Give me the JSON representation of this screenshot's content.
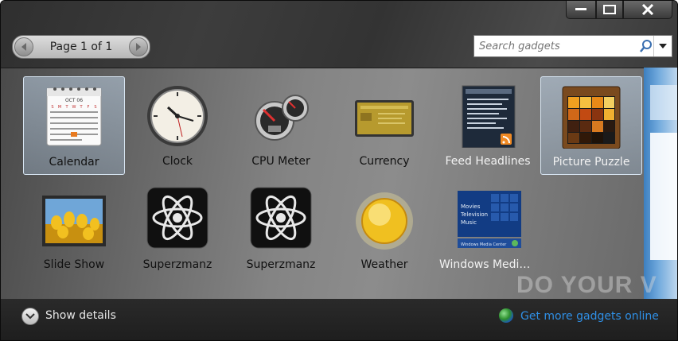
{
  "pager": {
    "label": "Page 1 of 1"
  },
  "search": {
    "placeholder": "Search gadgets"
  },
  "gadgets": [
    {
      "name": "Calendar",
      "icon": "calendar-icon",
      "selected": true
    },
    {
      "name": "Clock",
      "icon": "clock-icon"
    },
    {
      "name": "CPU Meter",
      "icon": "cpu-meter-icon"
    },
    {
      "name": "Currency",
      "icon": "currency-icon"
    },
    {
      "name": "Feed Headlines",
      "icon": "feed-headlines-icon"
    },
    {
      "name": "Picture Puzzle",
      "icon": "picture-puzzle-icon",
      "selected": true
    },
    {
      "name": "Slide Show",
      "icon": "slide-show-icon"
    },
    {
      "name": "Superzmanz",
      "icon": "atom-icon"
    },
    {
      "name": "Superzmanz",
      "icon": "atom-icon"
    },
    {
      "name": "Weather",
      "icon": "sun-icon"
    },
    {
      "name": "Windows Media...",
      "icon": "windows-media-icon"
    }
  ],
  "calendar": {
    "month": "OCT 06",
    "weekdays": [
      "S",
      "M",
      "T",
      "W",
      "T",
      "F",
      "S"
    ]
  },
  "wmc": {
    "menu": [
      "Movies",
      "Television",
      "Music"
    ],
    "caption": "Windows Media Center"
  },
  "background_text": "DO YOUR V",
  "footer": {
    "show_details": "Show details",
    "get_more": "Get more gadgets online"
  },
  "colors": {
    "selection": "#b9cde0",
    "link": "#2f8fe5"
  }
}
